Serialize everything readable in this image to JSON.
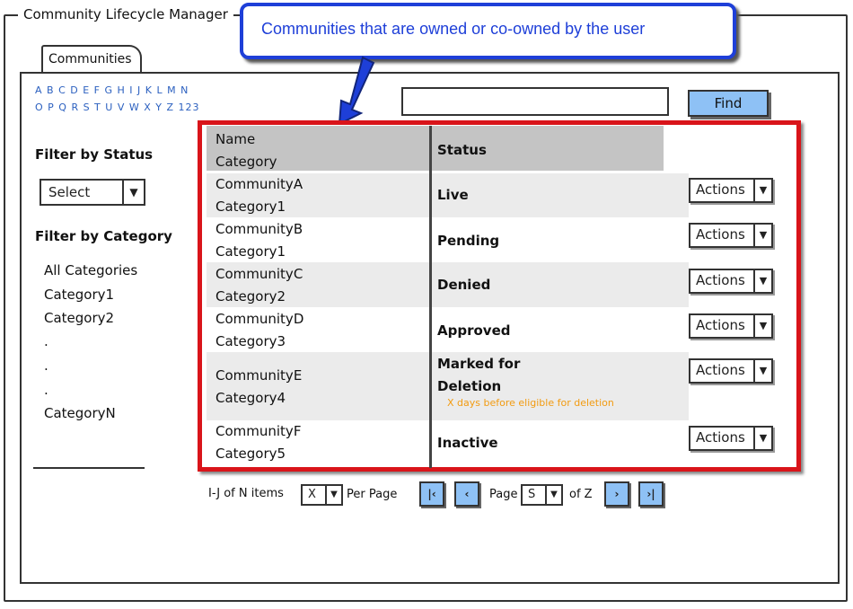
{
  "window": {
    "title": "Community Lifecycle Manager"
  },
  "tabs": [
    {
      "label": "Communities"
    }
  ],
  "callout": {
    "text": "Communities that are owned or co-owned by the user"
  },
  "alphabet": {
    "line1": "A B C D E F G H I J K L M N",
    "line2": "O P Q R S T U V W X Y Z 123"
  },
  "search": {
    "value": "",
    "button_label": "Find"
  },
  "filter_status": {
    "heading": "Filter by Status",
    "selected": "Select",
    "arrow": "▼"
  },
  "filter_category": {
    "heading": "Filter by Category",
    "items": [
      "All Categories",
      "Category1",
      "Category2",
      ".",
      ".",
      ".",
      "CategoryN"
    ]
  },
  "table": {
    "headers": {
      "name": "Name",
      "category": "Category",
      "status": "Status"
    },
    "rows": [
      {
        "name": "CommunityA",
        "category": "Category1",
        "status": "Live",
        "action": "Actions"
      },
      {
        "name": "CommunityB",
        "category": "Category1",
        "status": "Pending",
        "action": "Actions"
      },
      {
        "name": "CommunityC",
        "category": "Category2",
        "status": "Denied",
        "action": "Actions"
      },
      {
        "name": "CommunityD",
        "category": "Category3",
        "status": "Approved",
        "action": "Actions"
      },
      {
        "name": "CommunityE",
        "category": "Category4",
        "status_line1": "Marked for",
        "status_line2": "Deletion",
        "note": "X days before eligible for deletion",
        "action": "Actions"
      },
      {
        "name": "CommunityF",
        "category": "Category5",
        "status": "Inactive",
        "action": "Actions"
      }
    ],
    "action_arrow": "▼"
  },
  "pagination": {
    "range_text": "I-J of N items",
    "per_page_value": "X",
    "per_page_label": "Per Page",
    "page_label": "Page",
    "page_value": "S",
    "of_label": "of Z",
    "first": "|‹",
    "prev": "‹",
    "next": "›",
    "last": "›|"
  },
  "colors": {
    "accent": "#8ec1f5",
    "highlight_border": "#d9141a",
    "callout": "#1e3fd8",
    "link": "#2a5fbf",
    "note": "#f29b11"
  }
}
